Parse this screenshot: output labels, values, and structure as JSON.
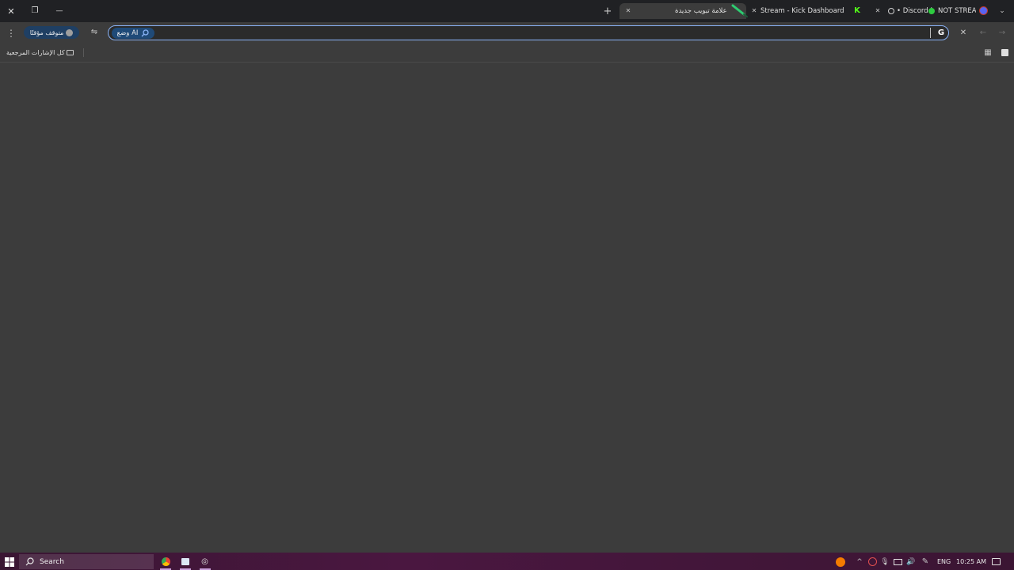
{
  "window_controls": {
    "close": "✕",
    "restore": "❐",
    "minimize": "—"
  },
  "tabs": [
    {
      "title": "علامة تبويب جديدة",
      "active": true
    },
    {
      "title": "Stream - Kick Dashboard",
      "active": false
    },
    {
      "title": "• Discord |",
      "active": false
    },
    {
      "title": "NOT STREAM",
      "active": false
    }
  ],
  "tab_controls": {
    "new_tab": "+",
    "close": "✕"
  },
  "toolbar": {
    "paused_label": "متوقف مؤقتًا",
    "ai_mode_label": "وضع AI",
    "omnibox_value": ""
  },
  "bookmarks": {
    "all_bookmarks": "كل الإشارات المرجعية"
  },
  "taskbar": {
    "search_label": "Search",
    "language": "ENG",
    "time": "10:25 AM"
  },
  "colors": {
    "accent": "#8ab4f8",
    "kick_green": "#53fc18",
    "discord_blurple": "#5865f2",
    "live_green": "#2ecc40",
    "taskbar": "#3e1639"
  }
}
